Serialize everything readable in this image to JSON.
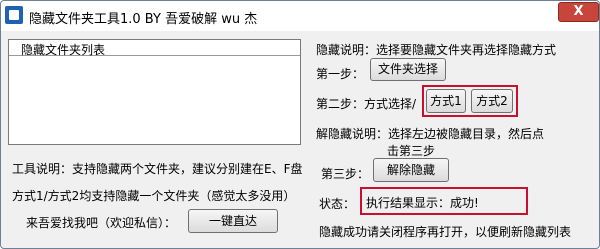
{
  "window": {
    "title": "隐藏文件夹工具1.0 BY 吾爱破解 wu 杰",
    "close_label": "X"
  },
  "list": {
    "header": "隐藏文件夹列表"
  },
  "left": {
    "tool_desc": "工具说明：支持隐藏两个文件夹，建议分别建在E、F盘",
    "method_desc": "方式1/方式2均支持隐藏一个文件夹（感觉太多没用）",
    "contact_label": "来吾爱找我吧（欢迎私信）：",
    "direct_button": "一键直达"
  },
  "right": {
    "hide_desc": "隐藏说明：选择要隐藏文件夹再选择隐藏方式",
    "step1_label": "第一步：",
    "folder_button": "文件夹选择",
    "step2_label": "第二步：方式选择/",
    "method1_button": "方式1",
    "method2_button": "方式2",
    "unhide_desc_line1": "解隐藏说明：选择左边被隐藏目录，然后点",
    "unhide_desc_line2": "击第三步",
    "step3_label": "第三步：",
    "unhide_button": "解除隐藏",
    "status_label": "状态：",
    "status_value": "执行结果显示：成功!",
    "footer_note": "隐藏成功请关闭程序再打开，以便刷新隐藏列表"
  },
  "colors": {
    "highlight_border": "#c8102e",
    "close_button": "#c8453c",
    "app_icon": "#1e62b8"
  }
}
